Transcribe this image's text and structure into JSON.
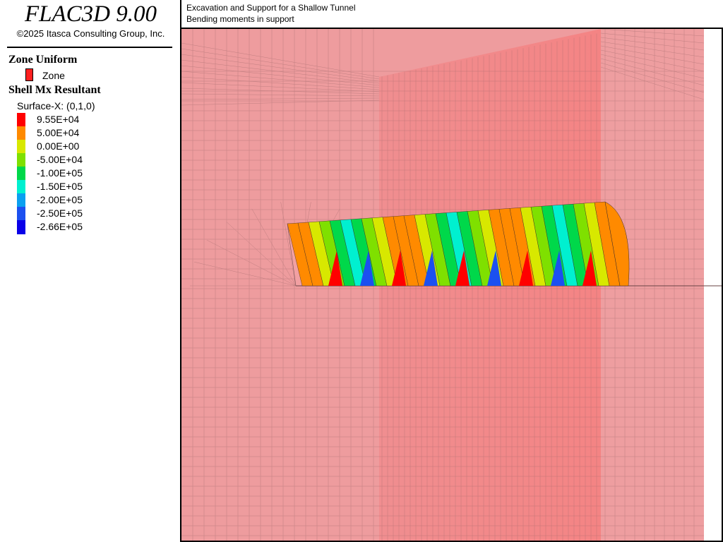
{
  "app": {
    "title": "FLAC3D 9.00",
    "copyright": "©2025 Itasca Consulting Group, Inc."
  },
  "header": {
    "line1": "Excavation and Support for a Shallow Tunnel",
    "line2": "Bending moments in support"
  },
  "legend": {
    "zone_section_title": "Zone Uniform",
    "zone_item_label": "Zone",
    "zone_color": "#ff2020",
    "shell_section_title": "Shell Mx Resultant",
    "surface_label": "Surface-X: (0,1,0)",
    "items": [
      {
        "label": "9.55E+04",
        "color": "#ff0000"
      },
      {
        "label": "5.00E+04",
        "color": "#ff8a00"
      },
      {
        "label": "0.00E+00",
        "color": "#d8e800"
      },
      {
        "label": "-5.00E+04",
        "color": "#7fe000"
      },
      {
        "label": "-1.00E+05",
        "color": "#00d84a"
      },
      {
        "label": "-1.50E+05",
        "color": "#00f0d0"
      },
      {
        "label": "-2.00E+05",
        "color": "#0aa0f0"
      },
      {
        "label": "-2.50E+05",
        "color": "#1c50f0"
      },
      {
        "label": "-2.66E+05",
        "color": "#0a00e8"
      }
    ]
  },
  "colors": {
    "model_light": "#ee9c9e",
    "model_mid": "#f48c8c",
    "mesh_line": "#a06a6c"
  }
}
